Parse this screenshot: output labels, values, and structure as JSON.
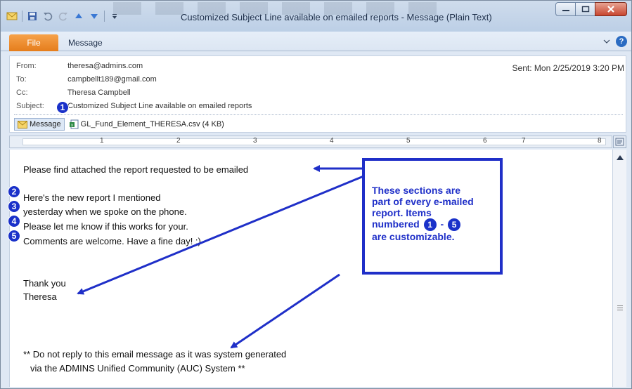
{
  "window": {
    "title": "Customized Subject Line available on emailed reports  -  Message (Plain Text)"
  },
  "ribbon": {
    "file_tab": "File",
    "message_tab": "Message",
    "help": "?"
  },
  "header": {
    "from_label": "From:",
    "from_value": "theresa@admins.com",
    "to_label": "To:",
    "to_value": "campbellt189@gmail.com",
    "cc_label": "Cc:",
    "cc_value": "Theresa Campbell",
    "subject_label": "Subject:",
    "subject_value": "Customized Subject Line available on emailed reports",
    "sent_label": "Sent:",
    "sent_value": "Mon 2/25/2019 3:20 PM",
    "message_tab": "Message",
    "attachment": "GL_Fund_Element_THERESA.csv (4 KB)"
  },
  "ruler": {
    "numbers": [
      "1",
      "2",
      "3",
      "4",
      "5",
      "6",
      "7",
      "8"
    ]
  },
  "body": {
    "line1": "Please find attached the report requested to be emailed",
    "line2": "Here's the new report I mentioned",
    "line3": "yesterday when we spoke on the phone.",
    "line4": "Please let me know if this works for your.",
    "line5": "Comments are welcome.  Have a fine day! :)",
    "thanks": "Thank you",
    "name": "Theresa",
    "footer1": "** Do not reply to this email message as it was system generated",
    "footer2": "via the ADMINS Unified Community (AUC) System **"
  },
  "markers": [
    "1",
    "2",
    "3",
    "4",
    "5"
  ],
  "callout": {
    "line1": "These sections are",
    "line2": "part of every e-mailed",
    "line3": "report. Items",
    "line4a": "numbered",
    "line4b": "1",
    "line4c": "-",
    "line4d": "5",
    "line5": "are customizable."
  },
  "colors": {
    "annotation_blue": "#1f2fc8",
    "file_tab": "#e57d1c"
  }
}
